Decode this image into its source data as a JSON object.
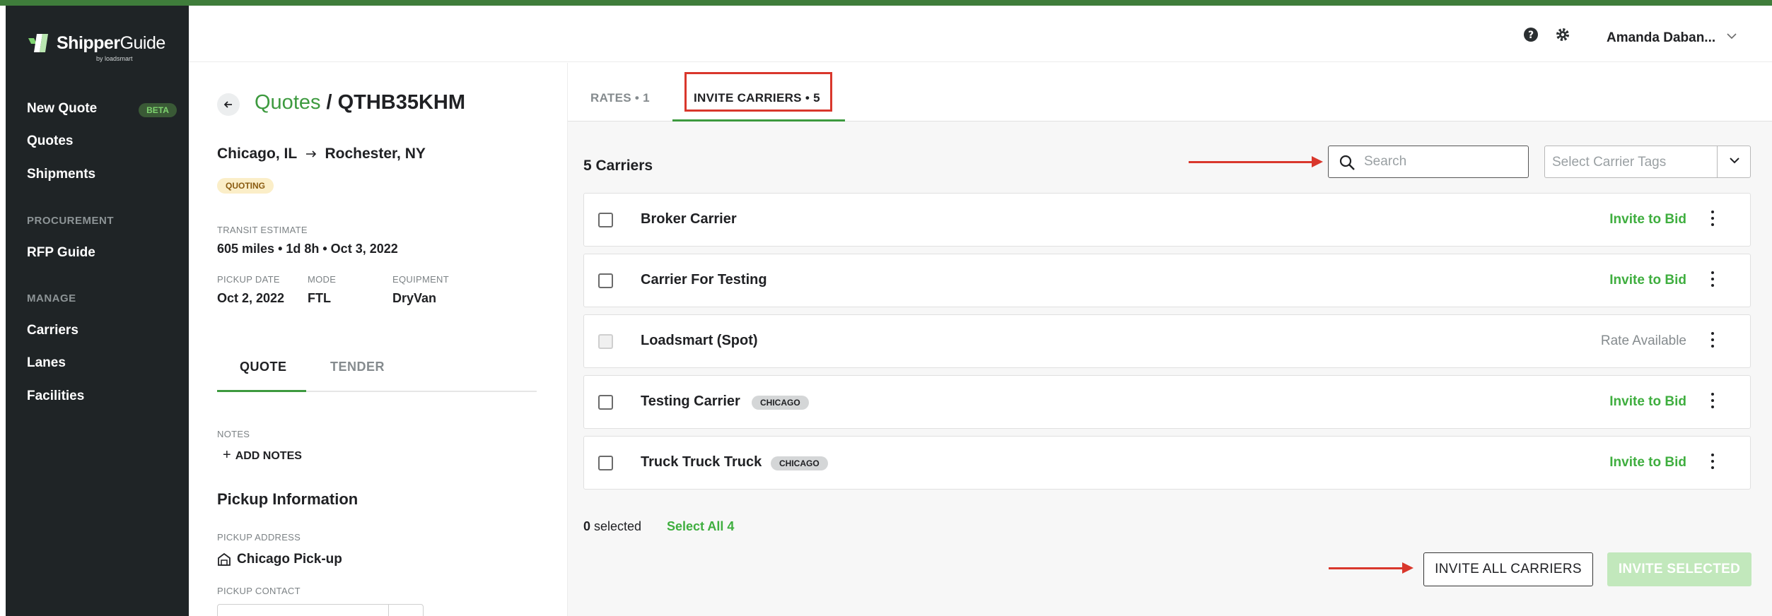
{
  "app": {
    "logo_bold": "Shipper",
    "logo_thin": "Guide",
    "logo_sub": "by loadsmart",
    "brand_color": "#3d9a3f",
    "accent_red": "#d9372c"
  },
  "sidebar": {
    "items": [
      {
        "label": "New Quote",
        "badge": "BETA"
      },
      {
        "label": "Quotes"
      },
      {
        "label": "Shipments"
      }
    ],
    "sections": [
      {
        "title": "PROCUREMENT",
        "items": [
          {
            "label": "RFP Guide"
          }
        ]
      },
      {
        "title": "MANAGE",
        "items": [
          {
            "label": "Carriers"
          },
          {
            "label": "Lanes"
          },
          {
            "label": "Facilities"
          }
        ]
      }
    ]
  },
  "header": {
    "help_icon": "help-icon",
    "settings_icon": "gear-icon",
    "user_name": "Amanda Daban..."
  },
  "quote": {
    "breadcrumb_link": "Quotes",
    "breadcrumb_sep": "/",
    "id": "QTHB35KHM",
    "origin": "Chicago, IL",
    "destination": "Rochester, NY",
    "status": "QUOTING",
    "transit_label": "TRANSIT ESTIMATE",
    "transit_value": "605 miles • 1d 8h • Oct 3, 2022",
    "pickup_date_label": "PICKUP DATE",
    "pickup_date": "Oct 2, 2022",
    "mode_label": "MODE",
    "mode": "FTL",
    "equipment_label": "EQUIPMENT",
    "equipment": "DryVan",
    "tabs": [
      "QUOTE",
      "TENDER"
    ],
    "notes_label": "NOTES",
    "add_notes": "ADD NOTES",
    "pickup_title": "Pickup Information",
    "pickup_address_label": "PICKUP ADDRESS",
    "pickup_address": "Chicago Pick-up",
    "pickup_contact_label": "PICKUP CONTACT"
  },
  "main": {
    "tabs": [
      {
        "label": "RATES • 1"
      },
      {
        "label": "INVITE CARRIERS • 5"
      }
    ],
    "carriers_count": "5 Carriers",
    "search_placeholder": "Search",
    "tags_placeholder": "Select Carrier Tags",
    "carriers": [
      {
        "name": "Broker Carrier",
        "tag": "",
        "action": "Invite to Bid"
      },
      {
        "name": "Carrier For Testing",
        "tag": "",
        "action": "Invite to Bid"
      },
      {
        "name": "Loadsmart (Spot)",
        "tag": "",
        "action": "Rate Available"
      },
      {
        "name": "Testing Carrier",
        "tag": "CHICAGO",
        "action": "Invite to Bid"
      },
      {
        "name": "Truck Truck Truck",
        "tag": "CHICAGO",
        "action": "Invite to Bid"
      }
    ],
    "selected_count": "0",
    "selected_text": " selected",
    "select_all": "Select All 4",
    "invite_all": "INVITE ALL CARRIERS",
    "invite_selected": "INVITE SELECTED"
  }
}
